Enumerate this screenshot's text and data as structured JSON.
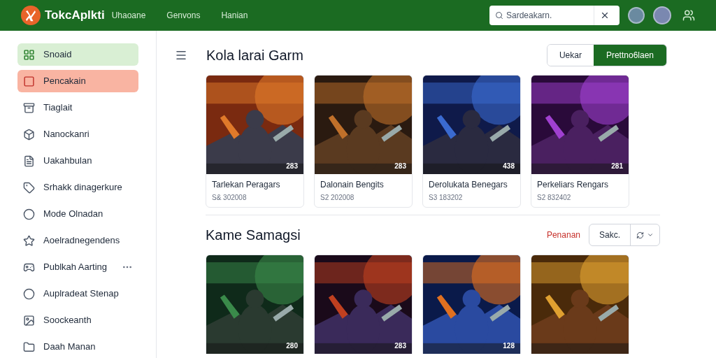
{
  "header": {
    "brand": "TokcAplkti",
    "nav": [
      "Uhaoane",
      "Genvons",
      "Hanian"
    ],
    "search": {
      "placeholder": "Sardeakarn."
    }
  },
  "sidebar": {
    "items": [
      {
        "label": "Snoaid",
        "selected": true,
        "flagged": false,
        "more": false
      },
      {
        "label": "Pencakain",
        "selected": false,
        "flagged": true,
        "more": false
      },
      {
        "label": "Tiaglait",
        "selected": false,
        "flagged": false,
        "more": false
      },
      {
        "label": "Nanockanri",
        "selected": false,
        "flagged": false,
        "more": false
      },
      {
        "label": "Uakahbulan",
        "selected": false,
        "flagged": false,
        "more": false
      },
      {
        "label": "Srhakk dinagerkure",
        "selected": false,
        "flagged": false,
        "more": false
      },
      {
        "label": "Mode Olnadan",
        "selected": false,
        "flagged": false,
        "more": false
      },
      {
        "label": "Aoelradnegendens",
        "selected": false,
        "flagged": false,
        "more": false
      },
      {
        "label": "Publkah Aarting",
        "selected": false,
        "flagged": false,
        "more": true
      },
      {
        "label": "Auplradeat Stenap",
        "selected": false,
        "flagged": false,
        "more": false
      },
      {
        "label": "Soockeanth",
        "selected": false,
        "flagged": false,
        "more": false
      },
      {
        "label": "Daah Manan",
        "selected": false,
        "flagged": false,
        "more": false
      }
    ]
  },
  "section1": {
    "title": "Kola larai Garm",
    "toggle": [
      {
        "label": "Uekar",
        "selected": false
      },
      {
        "label": "Prettno6laen",
        "selected": true
      }
    ],
    "cards": [
      {
        "kind": "picture",
        "title": "Tarlekan Peragars",
        "price": "S& 302008",
        "badge": "283"
      },
      {
        "kind": "picture",
        "title": "Dalonain Bengits",
        "price": "S2 202008",
        "badge": "283"
      },
      {
        "kind": "picture",
        "title": "Derolukata Benegars",
        "price": "S3 183202",
        "badge": "438"
      },
      {
        "kind": "picture",
        "title": "Perkeliars Rengars",
        "price": "S2 832402",
        "badge": "281"
      }
    ]
  },
  "section2": {
    "title": "Kame Samagsi",
    "link": "Penanan",
    "sort": "Sakc.",
    "cards": [
      {
        "kind": "picture",
        "badge": "280"
      },
      {
        "kind": "picture",
        "badge": "283"
      },
      {
        "kind": "picture",
        "badge": "128"
      },
      {
        "kind": "picture"
      }
    ]
  }
}
